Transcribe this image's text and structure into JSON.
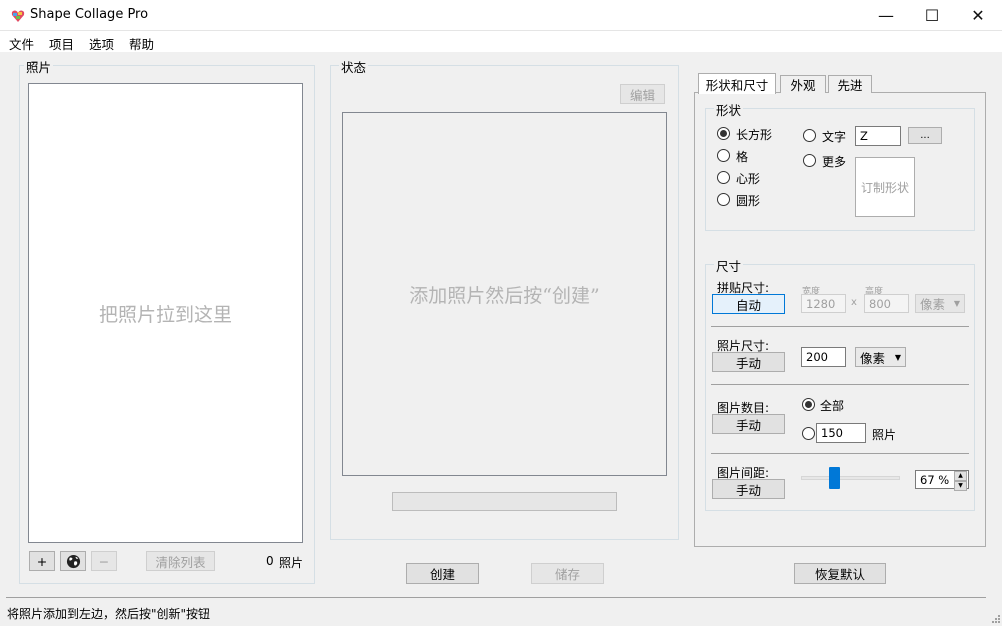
{
  "window": {
    "title": "Shape Collage Pro",
    "minimize_glyph": "—",
    "maximize_glyph": "☐",
    "close_glyph": "✕"
  },
  "menu": [
    "文件",
    "项目",
    "选项",
    "帮助"
  ],
  "photos": {
    "label": "照片",
    "drop_hint": "把照片拉到这里",
    "add_glyph": "+",
    "remove_glyph": "−",
    "clear_label": "清除列表",
    "count": "0",
    "count_unit": "照片"
  },
  "status_panel": {
    "label": "状态",
    "edit_label": "编辑",
    "hint": "添加照片然后按“创建”"
  },
  "actions": {
    "create_label": "创建",
    "save_label": "储存",
    "reset_label": "恢复默认"
  },
  "tabs": [
    "形状和尺寸",
    "外观",
    "先进"
  ],
  "shape": {
    "label": "形状",
    "options": [
      "长方形",
      "格",
      "心形",
      "圆形"
    ],
    "text_option": "文字",
    "more_option": "更多",
    "text_value": "Z",
    "ellipsis": "...",
    "custom_shape_label": "订制形状"
  },
  "size": {
    "label": "尺寸",
    "collage_size_label": "拼贴尺寸:",
    "auto_label": "自动",
    "width_label": "宽度",
    "height_label": "高度",
    "width_value": "1280",
    "x_sep": "x",
    "height_value": "800",
    "unit_disabled": "像素",
    "photo_size_label": "照片尺寸:",
    "photo_size_mode": "手动",
    "photo_size_value": "200",
    "photo_unit": "像素",
    "photo_count_label": "图片数目:",
    "photo_count_mode": "手动",
    "all_label": "全部",
    "count_value": "150",
    "count_unit": "照片",
    "spacing_label": "图片间距:",
    "spacing_mode": "手动",
    "spacing_value": "67 %",
    "spacing_percent": 0.32
  },
  "statusbar": {
    "text": "将照片添加到左边，然后按\"创新\"按钮"
  }
}
